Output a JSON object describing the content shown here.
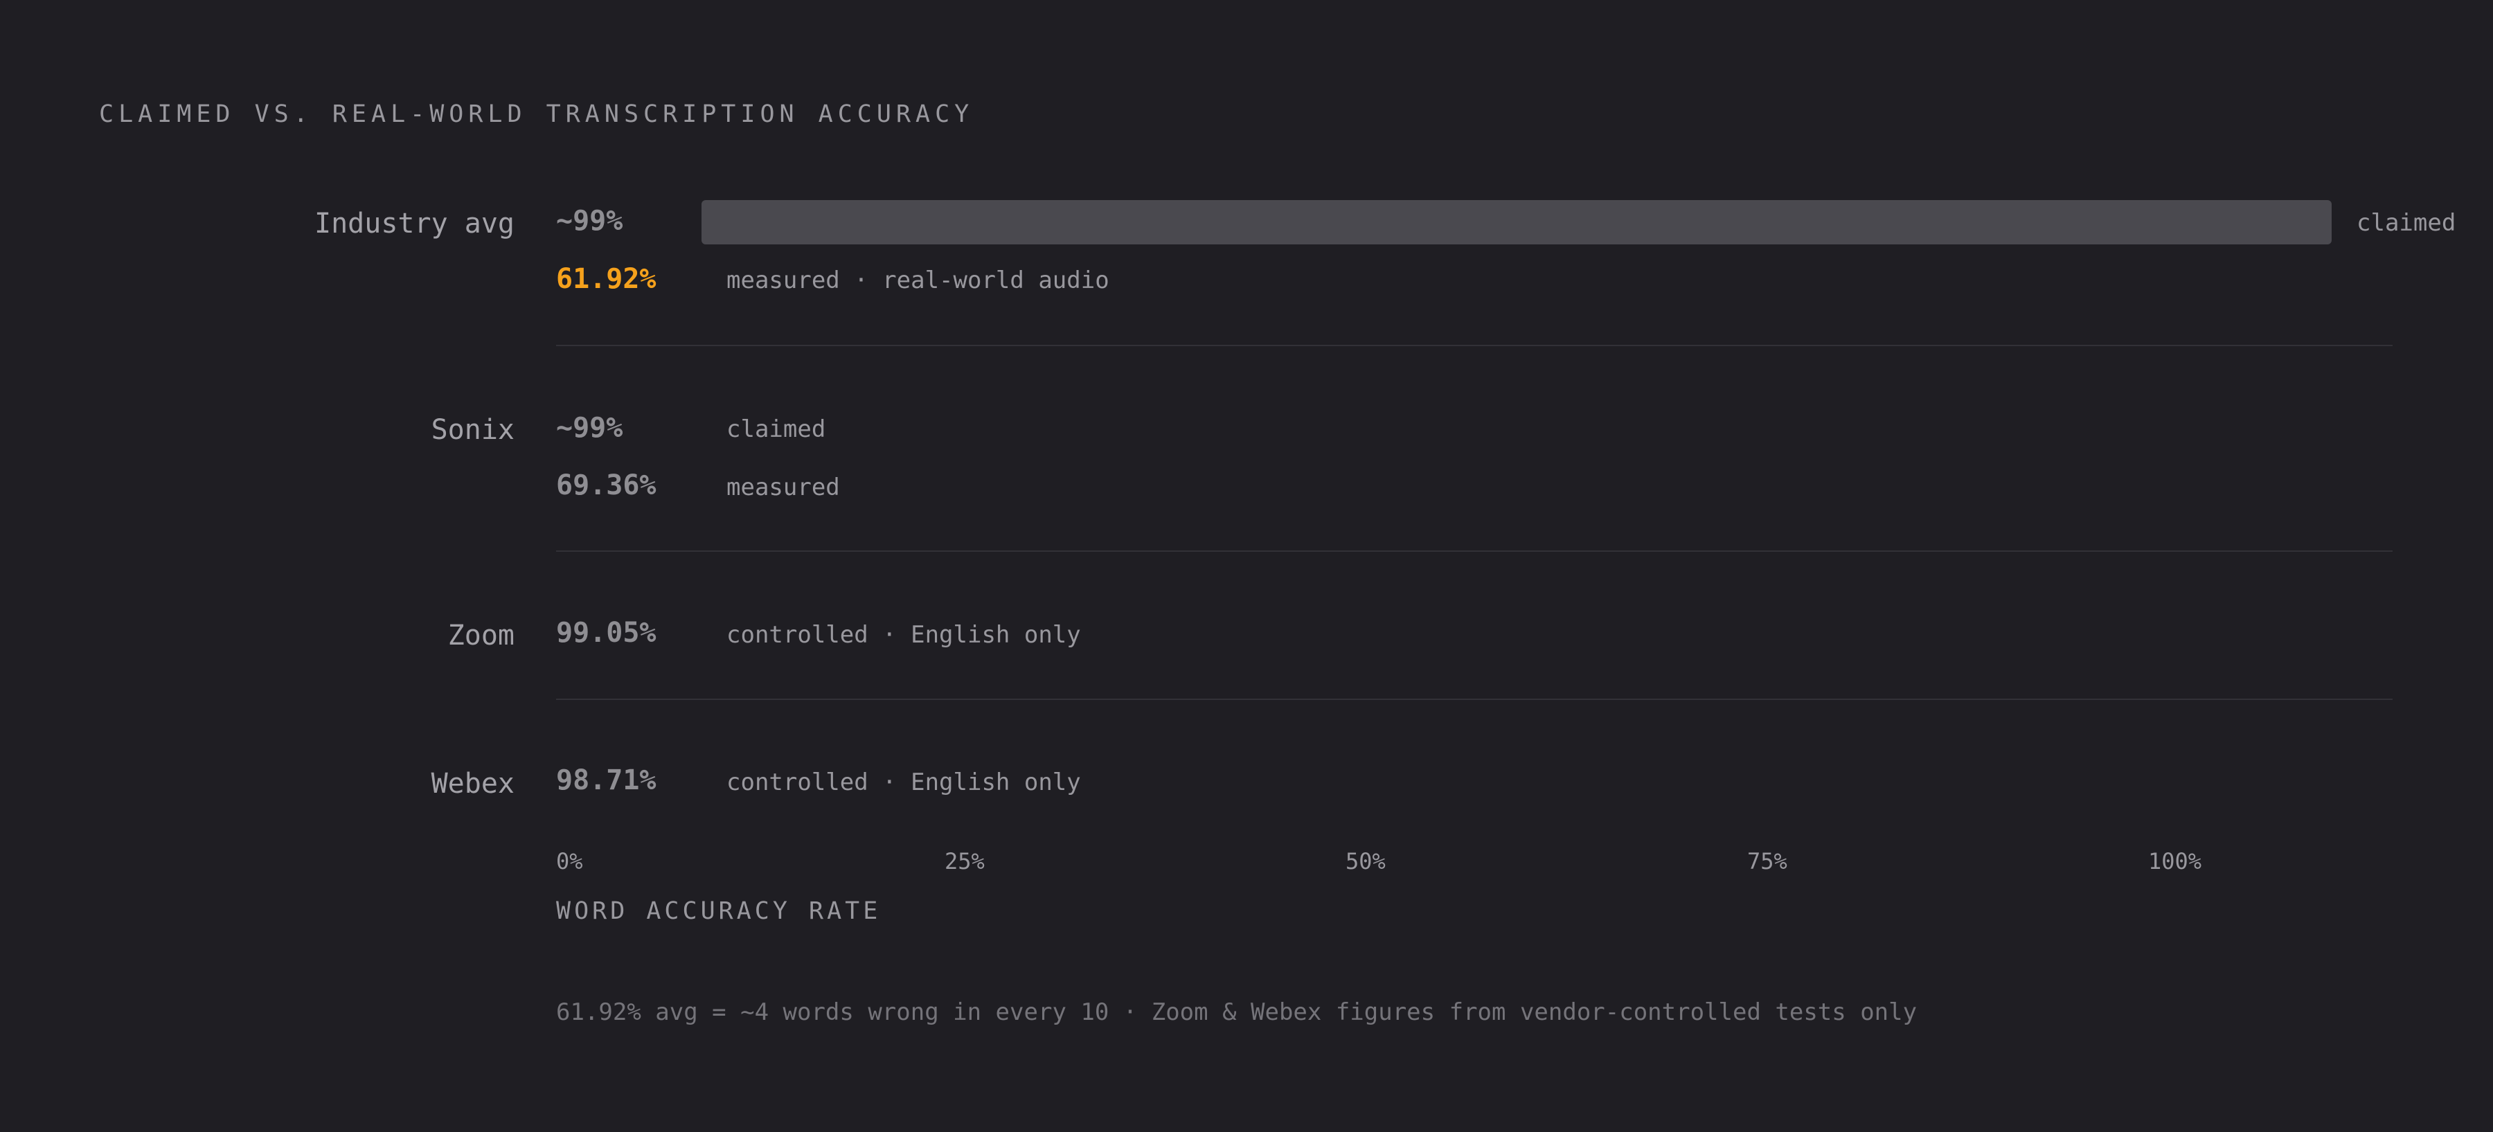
{
  "title": "CLAIMED VS. REAL-WORLD TRANSCRIPTION ACCURACY",
  "colors": {
    "background": "#1f1e23",
    "highlight": "#f5a11c",
    "bar": "#4a494f",
    "text": "#99989e"
  },
  "rows": [
    {
      "label": "Industry avg",
      "primary_value": "~99%",
      "primary_note": "claimed",
      "secondary_value": "61.92%",
      "secondary_note": "measured · real-world audio"
    },
    {
      "label": "Sonix",
      "primary_value": "~99%",
      "primary_note": "claimed",
      "secondary_value": "69.36%",
      "secondary_note": "measured"
    },
    {
      "label": "Zoom",
      "primary_value": "99.05%",
      "primary_note": "controlled · English only"
    },
    {
      "label": "Webex",
      "primary_value": "98.71%",
      "primary_note": "controlled · English only"
    }
  ],
  "chart_data": {
    "type": "bar",
    "xlabel": "WORD ACCURACY RATE",
    "xlim": [
      0,
      100
    ],
    "x_ticks": [
      "0%",
      "25%",
      "50%",
      "75%",
      "100%"
    ],
    "series": [
      {
        "name": "claimed",
        "categories": [
          "Industry avg"
        ],
        "values": [
          99
        ]
      }
    ],
    "values_by_row": [
      {
        "category": "Industry avg",
        "claimed": 99,
        "measured": 61.92
      },
      {
        "category": "Sonix",
        "claimed": 99,
        "measured": 69.36
      },
      {
        "category": "Zoom",
        "controlled": 99.05
      },
      {
        "category": "Webex",
        "controlled": 98.71
      }
    ]
  },
  "footnote": "61.92% avg = ~4 words wrong in every 10 · Zoom & Webex figures from vendor-controlled tests only"
}
